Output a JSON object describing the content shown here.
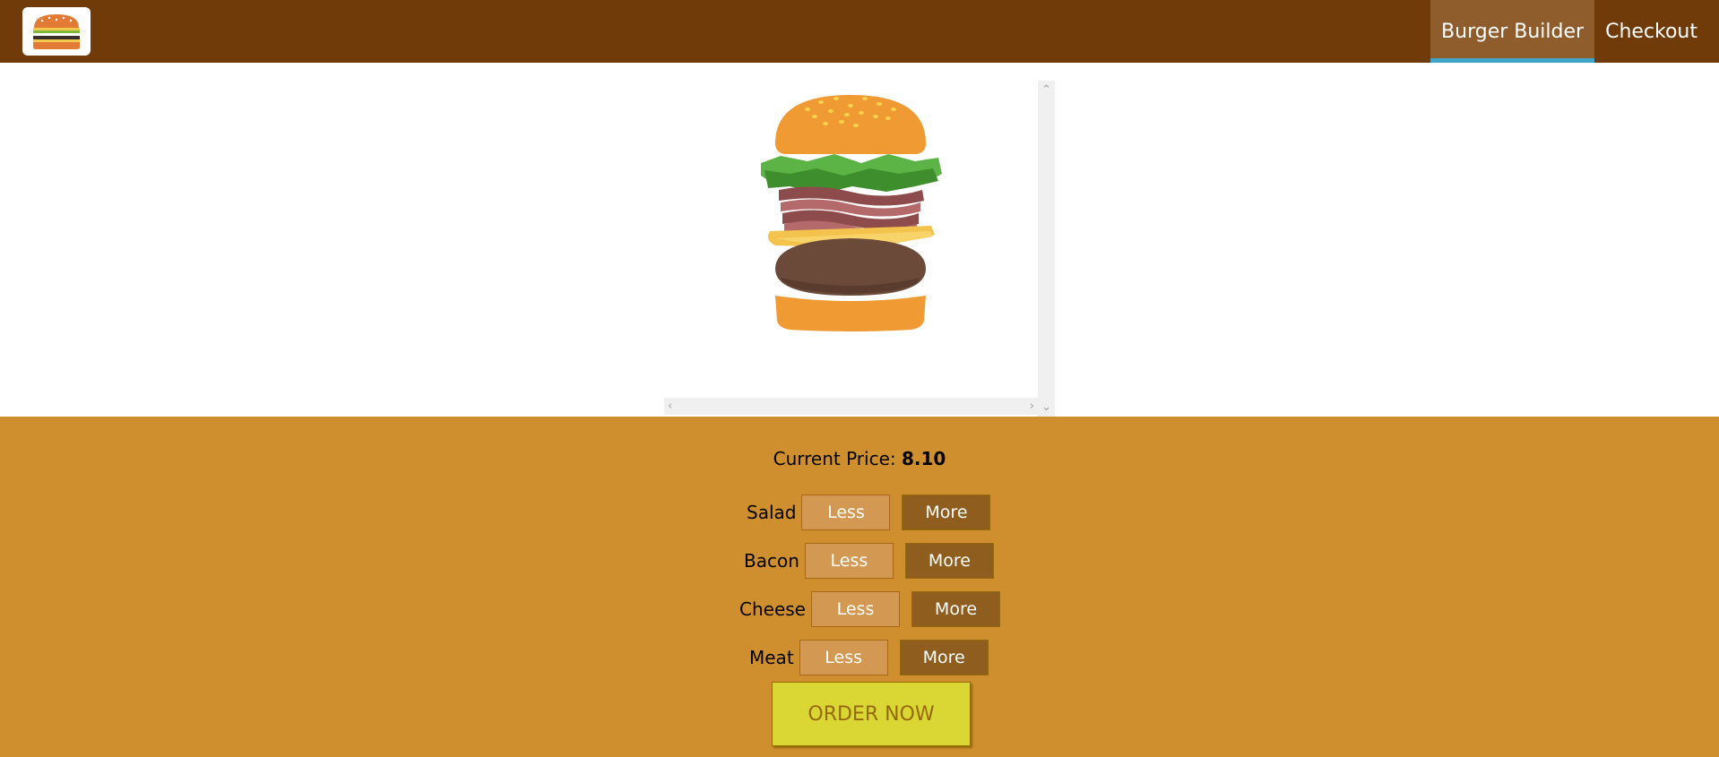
{
  "navigation": {
    "logo_alt": "MyBurger",
    "items": [
      {
        "label": "Burger Builder",
        "active": true
      },
      {
        "label": "Checkout",
        "active": false
      }
    ]
  },
  "build_controls": {
    "price_label": "Current Price:",
    "price_value": "8.10",
    "controls": [
      {
        "label": "Salad",
        "less": "Less",
        "more": "More"
      },
      {
        "label": "Bacon",
        "less": "Less",
        "more": "More"
      },
      {
        "label": "Cheese",
        "less": "Less",
        "more": "More"
      },
      {
        "label": "Meat",
        "less": "Less",
        "more": "More"
      }
    ],
    "order_button": "ORDER NOW"
  },
  "burger": {
    "ingredients": [
      "bread-top",
      "salad",
      "bacon",
      "cheese",
      "meat",
      "bread-bottom"
    ]
  },
  "colors": {
    "toolbar": "#703B09",
    "active_nav": "#8F5C2C",
    "active_underline": "#40A4C8",
    "controls_bg": "#CF8F2E",
    "less_button": "#D39952",
    "more_button": "#8F5E1E",
    "order_button": "#DAD735"
  }
}
